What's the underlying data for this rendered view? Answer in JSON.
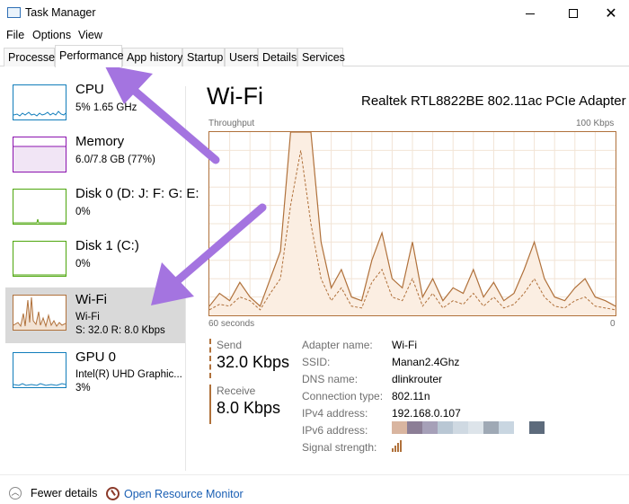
{
  "window": {
    "title": "Task Manager"
  },
  "menu": [
    "File",
    "Options",
    "View"
  ],
  "tabs": [
    "Processes",
    "Performance",
    "App history",
    "Startup",
    "Users",
    "Details",
    "Services"
  ],
  "active_tab": "Performance",
  "sidebar": {
    "items": [
      {
        "name": "CPU",
        "sub1": "5%  1.65 GHz",
        "sub2": "",
        "color": "#117dbb"
      },
      {
        "name": "Memory",
        "sub1": "6.0/7.8 GB (77%)",
        "sub2": "",
        "color": "#8b12ae"
      },
      {
        "name": "Disk 0 (D: J: F: G: E:",
        "sub1": "0%",
        "sub2": "",
        "color": "#4da60c"
      },
      {
        "name": "Disk 1 (C:)",
        "sub1": "0%",
        "sub2": "",
        "color": "#4da60c"
      },
      {
        "name": "Wi-Fi",
        "sub1": "Wi-Fi",
        "sub2": "S: 32.0  R: 8.0 Kbps",
        "color": "#b0713b"
      },
      {
        "name": "GPU 0",
        "sub1": "Intel(R) UHD Graphic...",
        "sub2": "3%",
        "color": "#117dbb"
      }
    ],
    "selected": "Wi-Fi"
  },
  "main": {
    "title": "Wi-Fi",
    "adapter": "Realtek RTL8822BE 802.11ac PCIe Adapter",
    "graph": {
      "label_top_left": "Throughput",
      "label_top_right": "100 Kbps",
      "label_bottom_left": "60 seconds",
      "label_bottom_right": "0",
      "accent_color": "#b0713b",
      "series_solid": [
        5,
        12,
        8,
        18,
        10,
        5,
        20,
        35,
        100,
        100,
        100,
        40,
        15,
        25,
        10,
        8,
        30,
        45,
        20,
        15,
        40,
        10,
        20,
        8,
        15,
        12,
        25,
        10,
        18,
        8,
        12,
        25,
        40,
        20,
        10,
        8,
        15,
        20,
        10,
        8,
        5
      ],
      "series_dashed": [
        3,
        6,
        5,
        10,
        8,
        3,
        12,
        20,
        60,
        90,
        50,
        20,
        8,
        15,
        5,
        4,
        18,
        25,
        10,
        8,
        20,
        5,
        12,
        4,
        8,
        6,
        12,
        5,
        10,
        4,
        6,
        12,
        20,
        10,
        5,
        4,
        8,
        10,
        5,
        4,
        3
      ]
    },
    "send": {
      "label": "Send",
      "value": "32.0 Kbps"
    },
    "receive": {
      "label": "Receive",
      "value": "8.0 Kbps"
    },
    "properties": [
      {
        "key": "Adapter name:",
        "value": "Wi-Fi"
      },
      {
        "key": "SSID:",
        "value": "Manan2.4Ghz"
      },
      {
        "key": "DNS name:",
        "value": "dlinkrouter"
      },
      {
        "key": "Connection type:",
        "value": "802.11n"
      },
      {
        "key": "IPv4 address:",
        "value": "192.168.0.107"
      },
      {
        "key": "IPv6 address:",
        "value": ""
      },
      {
        "key": "Signal strength:",
        "value": ""
      }
    ],
    "ipv6_redaction_colors": [
      "#d9b5a0",
      "#8c7e96",
      "#a6a0b8",
      "#b9c7d4",
      "#cfd9e2",
      "#dde4ea",
      "#9fa9b5",
      "#c9d6e1",
      "#ffffff",
      "#5d6b7c"
    ],
    "signal_bars": 4
  },
  "footer": {
    "fewer_details": "Fewer details",
    "open_monitor": "Open Resource Monitor"
  },
  "annotation_color": "#a474e0"
}
